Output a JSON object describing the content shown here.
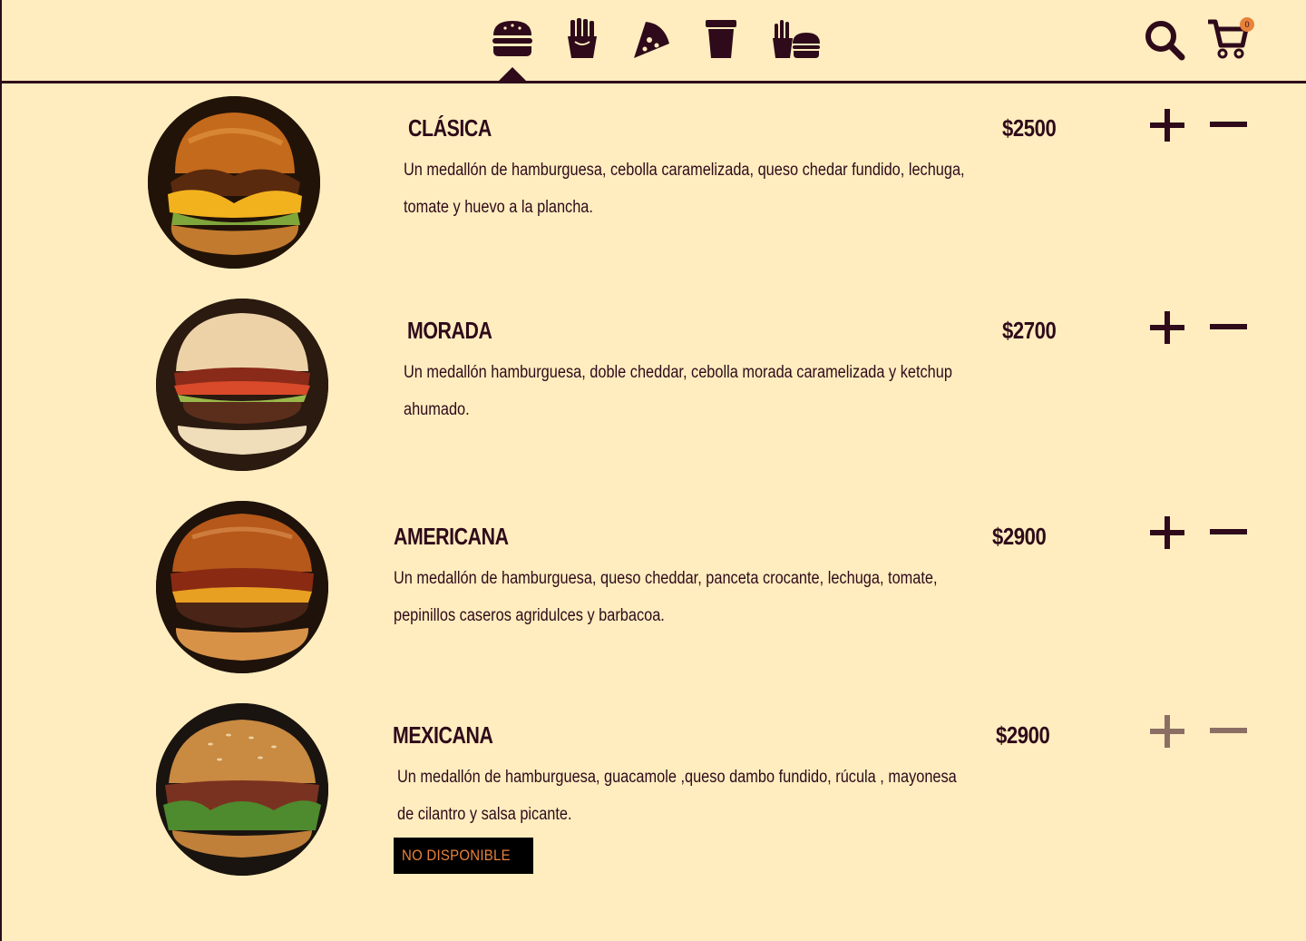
{
  "nav": {
    "categories": [
      {
        "icon": "burger-icon",
        "active": true
      },
      {
        "icon": "fries-icon",
        "active": false
      },
      {
        "icon": "pizza-icon",
        "active": false
      },
      {
        "icon": "drink-cup-icon",
        "active": false
      },
      {
        "icon": "combo-icon",
        "active": false
      }
    ],
    "cart_count": "0"
  },
  "colors": {
    "background": "#FFEDBF",
    "primary": "#2E0A1A",
    "accent": "#E8823A",
    "badge_bg": "#000000"
  },
  "menu": {
    "items": [
      {
        "name": "CLÁSICA",
        "price": "$2500",
        "desc": "Un medallón de hamburguesa, cebolla caramelizada, queso chedar fundido, lechuga, tomate y huevo a la plancha.",
        "available": true
      },
      {
        "name": "MORADA",
        "price": "$2700",
        "desc": "Un medallón hamburguesa, doble cheddar, cebolla morada caramelizada y ketchup ahumado.",
        "available": true
      },
      {
        "name": "AMERICANA",
        "price": "$2900",
        "desc": "Un medallón de hamburguesa, queso cheddar, panceta crocante, lechuga, tomate, pepinillos caseros agridulces y barbacoa.",
        "available": true
      },
      {
        "name": "MEXICANA",
        "price": "$2900",
        "desc": "Un medallón de hamburguesa,  guacamole ,queso dambo fundido, rúcula , mayonesa de cilantro y salsa picante.",
        "available": false,
        "badge": "NO DISPONIBLE"
      }
    ]
  }
}
